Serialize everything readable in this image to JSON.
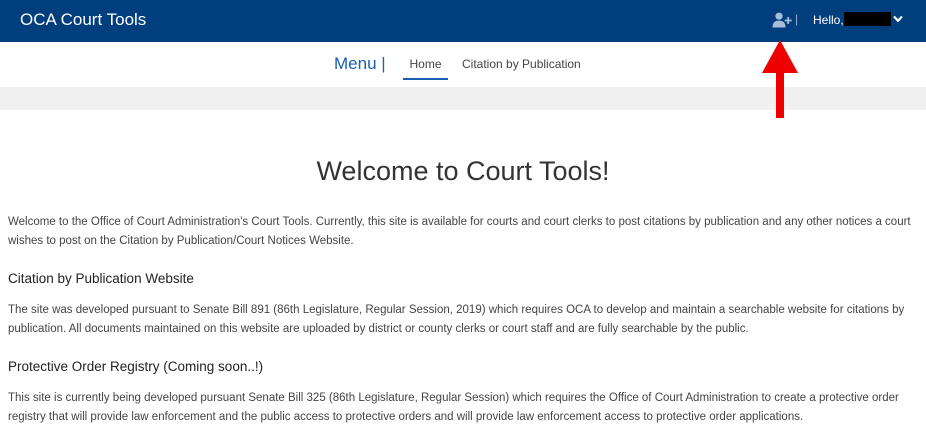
{
  "header": {
    "brand": "OCA Court Tools",
    "separator": "|",
    "hello_label": "Hello,"
  },
  "nav": {
    "menu_label": "Menu |",
    "items": [
      {
        "label": "Home",
        "active": true
      },
      {
        "label": "Citation by Publication",
        "active": false
      }
    ]
  },
  "main": {
    "title": "Welcome to Court Tools!",
    "intro": "Welcome to the Office of Court Administration's Court Tools. Currently, this site is available for courts and court clerks to post citations by publication and any other notices a court wishes to post on the Citation by Publication/Court Notices Website.",
    "sections": [
      {
        "heading": "Citation by Publication Website",
        "body": "The site was developed pursuant to Senate Bill 891 (86th Legislature, Regular Session, 2019) which requires OCA to develop and maintain a searchable website for citations by publication. All documents maintained on this website are uploaded by district or county clerks or court staff and are fully searchable by the public."
      },
      {
        "heading": "Protective Order Registry (Coming soon..!)",
        "body": "This site is currently being developed pursuant Senate Bill 325 (86th Legislature, Regular Session) which requires the Office of Court Administration to create a protective order registry that will provide law enforcement and the public access to protective orders and will provide law enforcement access to protective order applications."
      }
    ]
  },
  "icons": {
    "add_user": "add-user-icon",
    "chevron": "chevron-down-icon",
    "annotation": "red-arrow-annotation"
  },
  "colors": {
    "header_bg": "#003e7e",
    "accent": "#1a5fb4",
    "arrow": "#ee0000"
  }
}
